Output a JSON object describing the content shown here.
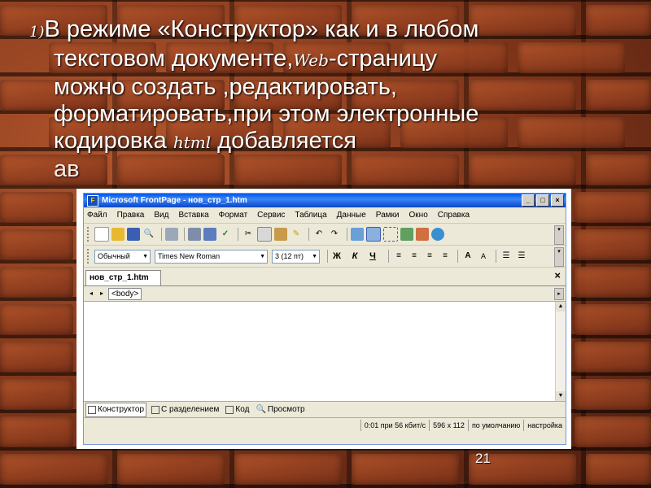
{
  "slide": {
    "number_prefix": "1)",
    "line1": "В режиме «Конструктор» как и в любом",
    "line2a": "текстовом документе,",
    "line2_script": "Web",
    "line2b": "-страницу",
    "line3": "можно создать ,редактировать,",
    "line4": "форматировать,при этом электронные",
    "line5a": "кодировка ",
    "line5_script": "html",
    "line5b": " добавляется",
    "line6_partial": "ав",
    "page_number": "21"
  },
  "window": {
    "title": "Microsoft FrontPage - нов_стр_1.htm",
    "min": "_",
    "max": "□",
    "close": "×",
    "menu": [
      "Файл",
      "Правка",
      "Вид",
      "Вставка",
      "Формат",
      "Сервис",
      "Таблица",
      "Данные",
      "Рамки",
      "Окно",
      "Справка"
    ],
    "format": {
      "style": "Обычный",
      "font": "Times New Roman",
      "size": "3  (12 пт)",
      "bold": "Ж",
      "italic": "К",
      "underline": "Ч"
    },
    "doc_tab": "нов_стр_1.htm",
    "doc_close": "×",
    "tag": "<body>",
    "views": [
      "Конструктор",
      "С разделением",
      "Код",
      "Просмотр"
    ],
    "status": [
      "0:01 при 56 кбит/с",
      "596 x 112",
      "по умолчанию",
      "настройка"
    ]
  }
}
